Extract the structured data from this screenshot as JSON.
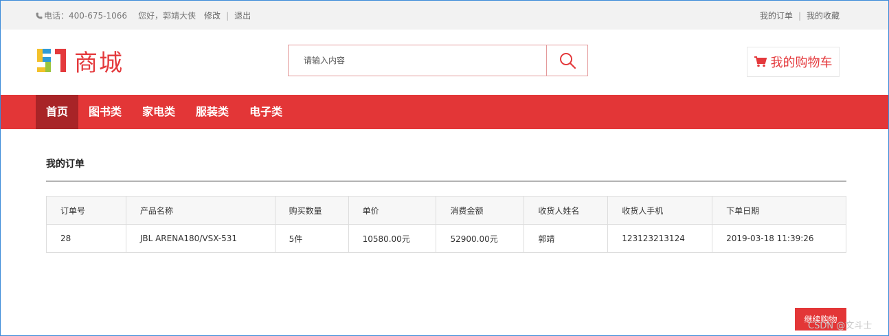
{
  "topbar": {
    "phone_label": "电话：",
    "phone": "400-675-1066",
    "greeting": "您好，郭靖大侠",
    "edit": "修改",
    "divider": "|",
    "logout": "退出",
    "my_orders": "我的订单",
    "my_favorites": "我的收藏"
  },
  "logo": {
    "text": "商城"
  },
  "search": {
    "placeholder": "请输入内容"
  },
  "cart": {
    "label": "我的购物车"
  },
  "nav": {
    "items": [
      "首页",
      "图书类",
      "家电类",
      "服装类",
      "电子类"
    ]
  },
  "main": {
    "title": "我的订单",
    "table": {
      "headers": [
        "订单号",
        "产品名称",
        "购买数量",
        "单价",
        "消费金额",
        "收货人姓名",
        "收货人手机",
        "下单日期"
      ],
      "rows": [
        [
          "28",
          "JBL ARENA180/VSX-531",
          "5件",
          "10580.00元",
          "52900.00元",
          "郭靖",
          "123123213124",
          "2019-03-18 11:39:26"
        ]
      ]
    },
    "continue_button": "继续购物"
  },
  "watermark": "CSDN @文斗士",
  "colors": {
    "brand_red": "#e33637",
    "nav_active": "#a82427",
    "topbar_bg": "#f2f2f2"
  }
}
